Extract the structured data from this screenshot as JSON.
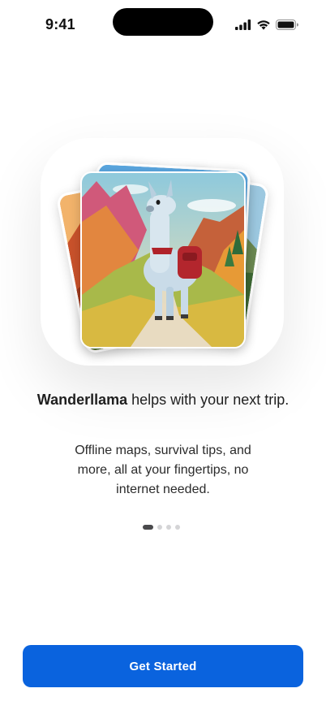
{
  "status_bar": {
    "time": "9:41",
    "icons": [
      "cellular-signal-icon",
      "wifi-icon",
      "battery-icon"
    ]
  },
  "hero": {
    "image": "illustration of a llama with a red backpack walking through a mountain valley",
    "stacked_cards": [
      "red-rock-canyon-card",
      "forest-card",
      "sky-card",
      "llama-valley-card"
    ]
  },
  "onboarding": {
    "headline_brand": "Wanderllama",
    "headline_rest": " helps with your next trip.",
    "description": "Offline maps, survival tips, and more, all at your fingertips, no internet needed."
  },
  "pagination": {
    "total": 4,
    "current": 1
  },
  "cta": {
    "label": "Get Started"
  },
  "colors": {
    "accent": "#0a63de",
    "text": "#1f1f1f",
    "dot_active": "#4a4a4c",
    "dot_inactive": "#d4d4d6"
  }
}
